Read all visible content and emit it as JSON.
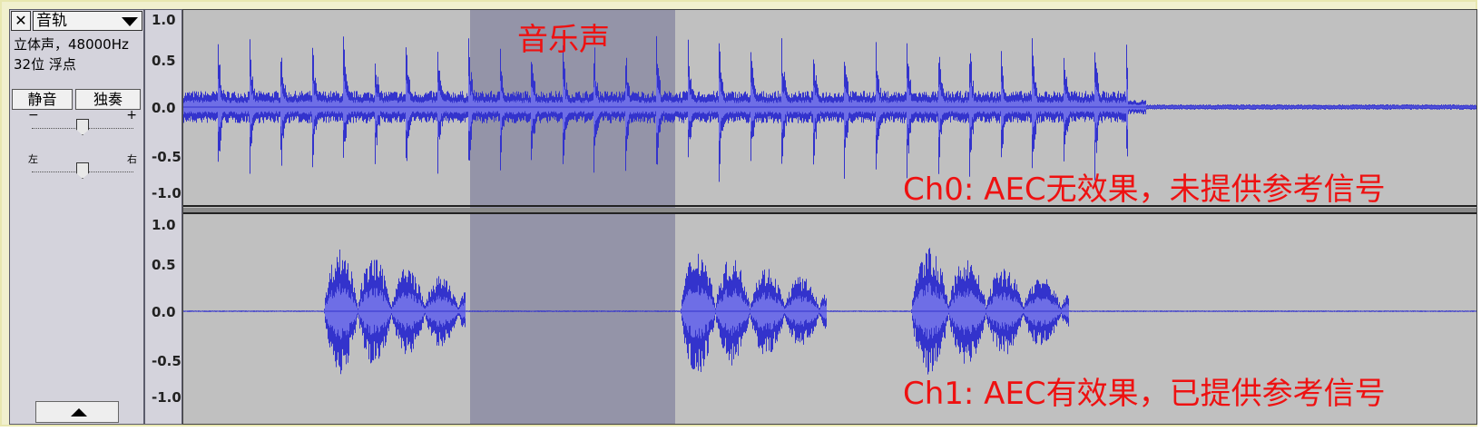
{
  "track": {
    "close_glyph": "✕",
    "name": "音轨",
    "info_line1": "立体声，48000Hz",
    "info_line2": "32位 浮点",
    "mute_label": "静音",
    "solo_label": "独奏",
    "gain_minus": "−",
    "gain_plus": "+",
    "pan_left": "左",
    "pan_right": "右",
    "gain_level": 0.5,
    "pan_level": 0.5
  },
  "ruler": {
    "ch0_ticks": [
      "1.0",
      "0.5",
      "0.0",
      "-0.5",
      "-1.0"
    ],
    "ch1_ticks": [
      "1.0",
      "0.5",
      "0.0",
      "-0.5",
      "-1.0"
    ]
  },
  "annotations": {
    "selection_label": "音乐声",
    "ch0_label": "Ch0: AEC无效果，未提供参考信号",
    "ch1_label": "Ch1: AEC有效果，已提供参考信号"
  },
  "colors": {
    "wave_dark": "#3333cc",
    "wave_light": "#6e6ee6",
    "selection": "#9494a8",
    "background": "#c0c0c0",
    "annotation": "#ee1111"
  }
}
